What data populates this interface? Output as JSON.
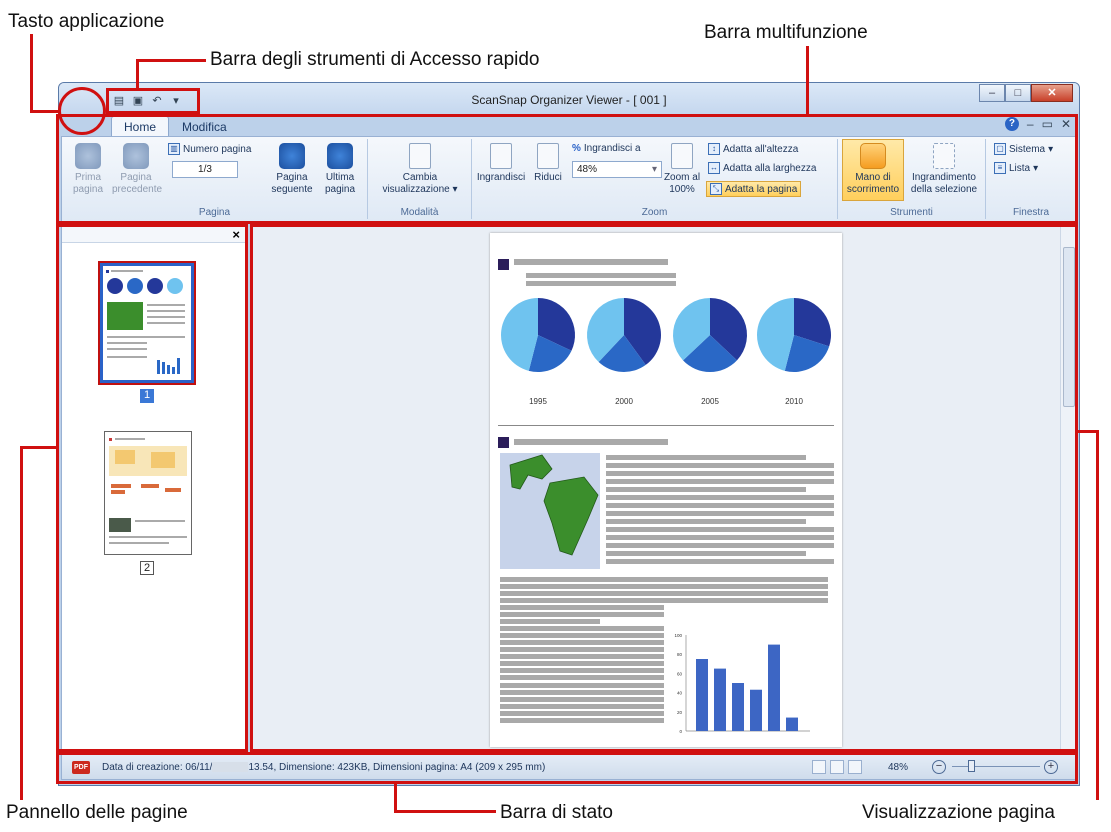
{
  "callouts": {
    "app_button": "Tasto applicazione",
    "quick_access": "Barra degli strumenti di Accesso rapido",
    "ribbon": "Barra multifunzione",
    "pages_panel": "Pannello delle pagine",
    "status_bar": "Barra di stato",
    "page_view": "Visualizzazione pagina"
  },
  "window": {
    "title": "ScanSnap Organizer Viewer - [ 001 ]"
  },
  "tabs": [
    "Home",
    "Modifica"
  ],
  "ribbon": {
    "pagina": {
      "label": "Pagina",
      "first": "Prima pagina",
      "prev": "Pagina precedente",
      "page_number_label": "Numero pagina",
      "page_number_value": "1/3",
      "next": "Pagina seguente",
      "last": "Ultima pagina"
    },
    "modalita": {
      "label": "Modalità",
      "change_view": "Cambia visualizzazione"
    },
    "zoom": {
      "label": "Zoom",
      "zoom_in": "Ingrandisci",
      "zoom_out": "Riduci",
      "zoom_to_label": "Ingrandisci a",
      "zoom_value": "48%",
      "zoom_100": "Zoom al 100%",
      "fit_height": "Adatta all'altezza",
      "fit_width": "Adatta alla larghezza",
      "fit_page": "Adatta la pagina"
    },
    "strumenti": {
      "label": "Strumenti",
      "hand": "Mano di scorrimento",
      "selection_zoom": "Ingrandimento della selezione"
    },
    "finestra": {
      "label": "Finestra",
      "system": "Sistema",
      "list": "Lista"
    }
  },
  "thumbnails": [
    {
      "number": "1"
    },
    {
      "number": "2"
    }
  ],
  "document": {
    "pie_years": [
      "1995",
      "2000",
      "2005",
      "2010"
    ],
    "pie_shares": [
      [
        0.32,
        0.22,
        0.46
      ],
      [
        0.4,
        0.22,
        0.38
      ],
      [
        0.37,
        0.26,
        0.37
      ],
      [
        0.3,
        0.24,
        0.46
      ]
    ],
    "bar_axis": [
      "100",
      "80",
      "60",
      "40",
      "20",
      "0"
    ],
    "bar_values": [
      75,
      65,
      50,
      43,
      90,
      14
    ],
    "colors": {
      "dark": "#24389a",
      "mid": "#2a68c6",
      "light": "#6fc3ef",
      "land": "#3b8e2c",
      "sea": "#c7d3ea"
    }
  },
  "status": {
    "pdf_badge": "PDF",
    "info_before": "Data di creazione: 06/11/",
    "info_after": "13.54, Dimensione: 423KB, Dimensioni pagina: A4 (209 x 295 mm)",
    "zoom": "48%"
  }
}
